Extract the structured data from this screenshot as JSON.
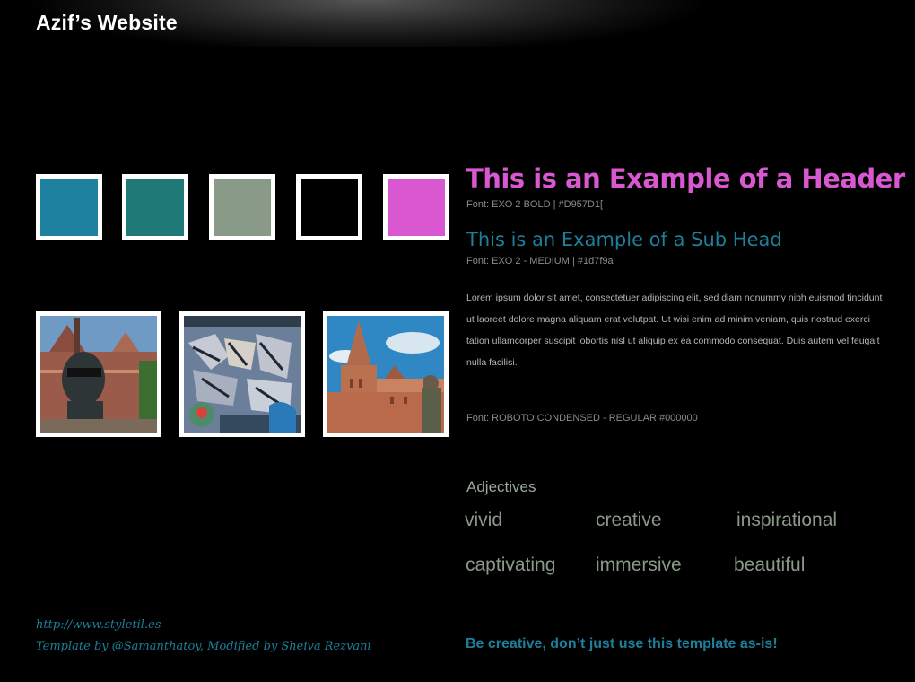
{
  "site": {
    "title": "Azif’s Website"
  },
  "swatches": [
    {
      "color": "#1e81a0"
    },
    {
      "color": "#1f7977"
    },
    {
      "color": "#8a9a88"
    },
    {
      "color": "#000000"
    },
    {
      "color": "#D957D1"
    }
  ],
  "photos": [
    {
      "alt": "statue-in-front-of-brick-buildings"
    },
    {
      "alt": "graffiti-wall"
    },
    {
      "alt": "old-cathedral-towers"
    }
  ],
  "typography": {
    "header_text": "This is an Example of a Header",
    "header_font_note": "Font: EXO 2 BOLD  |  #D957D1[",
    "subhead_text": "This is an Example of a Sub Head",
    "subhead_font_note": "Font: EXO 2 - MEDIUM  |  #1d7f9a",
    "body_text": "Lorem ipsum dolor sit amet, consectetuer adipiscing elit, sed diam nonummy nibh euismod tincidunt ut laoreet dolore magna aliquam erat volutpat. Ut wisi enim ad minim veniam, quis nostrud exerci tation ullamcorper suscipit lobortis nisl ut aliquip ex ea commodo consequat. Duis autem vel feugait nulla facilisi.",
    "body_font_note": "Font: ROBOTO CONDENSED - REGULAR #000000"
  },
  "adjectives": {
    "title": "Adjectives",
    "items": [
      "vivid",
      "creative",
      "inspirational",
      "captivating",
      "immersive",
      "beautiful"
    ]
  },
  "footer": {
    "url": "http://www.styletil.es",
    "credit": "Template by @Samanthatoy, Modified by Sheiva Rezvani",
    "tagline": "Be creative, don’t just use this template as-is!"
  },
  "colors": {
    "header": "#D957D1",
    "subhead": "#1d7f9a",
    "background": "#000000"
  }
}
